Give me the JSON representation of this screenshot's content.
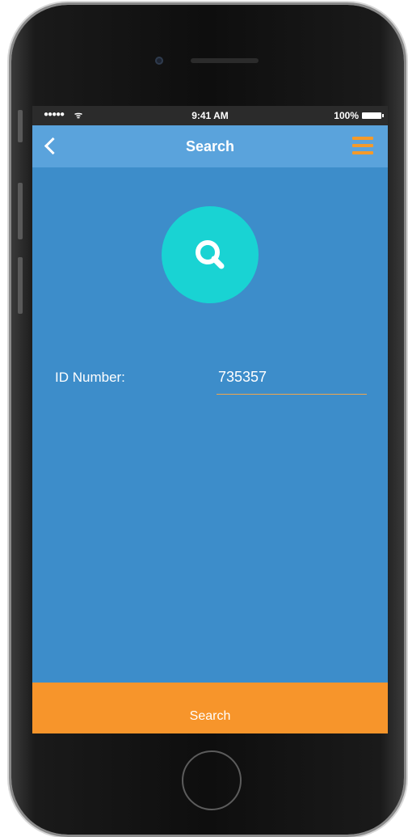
{
  "status_bar": {
    "signal": "●●●●●",
    "wifi": "ᯤ",
    "time": "9:41 AM",
    "battery_percent": "100%"
  },
  "navbar": {
    "title": "Search",
    "back_icon": "chevron-left-icon",
    "menu_icon": "hamburger-menu-icon"
  },
  "hero": {
    "icon": "magnifier-icon"
  },
  "form": {
    "id_label": "ID Number:",
    "id_value": "735357"
  },
  "footer": {
    "search_button_label": "Search"
  },
  "colors": {
    "screen_background": "#3d8dca",
    "navbar_background": "#5aa3dc",
    "accent_orange": "#f7952b",
    "search_circle": "#19d3d3"
  }
}
